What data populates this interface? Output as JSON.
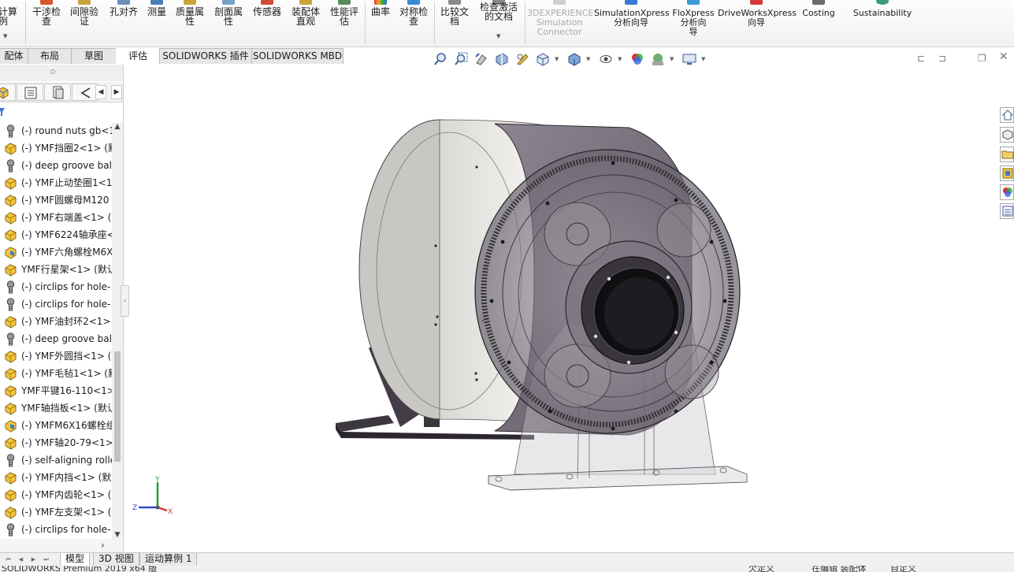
{
  "ribbon": {
    "buttons": [
      {
        "label": "计算\n例"
      },
      {
        "label": "干涉检\n查"
      },
      {
        "label": "间隙验\n证"
      },
      {
        "label": "孔对齐"
      },
      {
        "label": "测量"
      },
      {
        "label": "质量属\n性"
      },
      {
        "label": "剖面属\n性"
      },
      {
        "label": "传感器"
      },
      {
        "label": "装配体\n直观"
      },
      {
        "label": "性能评\n估"
      },
      {
        "label": "曲率"
      },
      {
        "label": "对称检\n查"
      },
      {
        "label": "比较文\n档"
      },
      {
        "label": "检查激活\n的文档"
      },
      {
        "label": "3DEXPERIENCE\nSimulation\nConnector"
      },
      {
        "label": "SimulationXpress\n分析向导"
      },
      {
        "label": "FloXpress\n分析向\n导"
      },
      {
        "label": "DriveWorksXpress\n向导"
      },
      {
        "label": "Costing"
      },
      {
        "label": "Sustainability"
      }
    ]
  },
  "command_tabs": [
    {
      "label": "配体"
    },
    {
      "label": "布局"
    },
    {
      "label": "草图"
    },
    {
      "label": "评估"
    },
    {
      "label": "SOLIDWORKS 插件"
    },
    {
      "label": "SOLIDWORKS MBD"
    }
  ],
  "tree": {
    "items": [
      {
        "icon": "fastener-icon",
        "label": "(-) round nuts gb<1"
      },
      {
        "icon": "part-icon",
        "label": "(-) YMF挡圈2<1> (默"
      },
      {
        "icon": "fastener-icon",
        "label": "(-) deep groove bal"
      },
      {
        "icon": "part-icon",
        "label": "(-) YMF止动垫圈1<1"
      },
      {
        "icon": "part-icon",
        "label": "(-) YMF圆螺母M120"
      },
      {
        "icon": "part-icon",
        "label": "(-) YMF右端盖<1> (默"
      },
      {
        "icon": "part-icon",
        "label": "(-) YMF6224轴承座<"
      },
      {
        "icon": "subassembly-icon",
        "label": "(-) YMF六角螺栓M6X"
      },
      {
        "icon": "part-icon",
        "label": "YMF行星架<1> (默认"
      },
      {
        "icon": "fastener-icon",
        "label": "(-) circlips for hole-"
      },
      {
        "icon": "fastener-icon",
        "label": "(-) circlips for hole-"
      },
      {
        "icon": "part-icon",
        "label": "(-) YMF油封环2<1>"
      },
      {
        "icon": "fastener-icon",
        "label": "(-) deep groove bal"
      },
      {
        "icon": "part-icon",
        "label": "(-) YMF外圆挡<1> (默"
      },
      {
        "icon": "part-icon",
        "label": "(-) YMF毛毡1<1> (默"
      },
      {
        "icon": "part-icon",
        "label": "YMF平键16-110<1>"
      },
      {
        "icon": "part-icon",
        "label": "YMF轴挡板<1> (默认"
      },
      {
        "icon": "subassembly-icon",
        "label": "(-) YMFM6X16螺栓组"
      },
      {
        "icon": "part-icon",
        "label": "(-) YMF轴20-79<1>"
      },
      {
        "icon": "fastener-icon",
        "label": "(-) self-aligning rolle"
      },
      {
        "icon": "part-icon",
        "label": "(-) YMF内挡<1> (默认"
      },
      {
        "icon": "part-icon",
        "label": "(-) YMF内齿轮<1> (默"
      },
      {
        "icon": "part-icon",
        "label": "(-) YMF左支架<1> (默"
      },
      {
        "icon": "fastener-icon",
        "label": "(-) circlips for hole-"
      }
    ]
  },
  "bottom_tabs": [
    {
      "label": "模型"
    },
    {
      "label": "3D 视图"
    },
    {
      "label": "运动算例 1"
    }
  ],
  "status": {
    "left": "SOLIDWORKS Premium 2019 x64 版",
    "mid1": "欠定义",
    "mid2": "在编辑 装配体",
    "right": "自定义"
  },
  "triad": {
    "x": "X",
    "y": "Y",
    "z": "Z"
  },
  "colors": {
    "accent_blue": "#2a6ad6",
    "tab_bg": "#e6e6e6",
    "model_body": "#7b7380",
    "model_dark": "#3a343c",
    "axis_x": "#d23a2a",
    "axis_y": "#2a9a3a",
    "axis_z": "#2a4ad6"
  }
}
